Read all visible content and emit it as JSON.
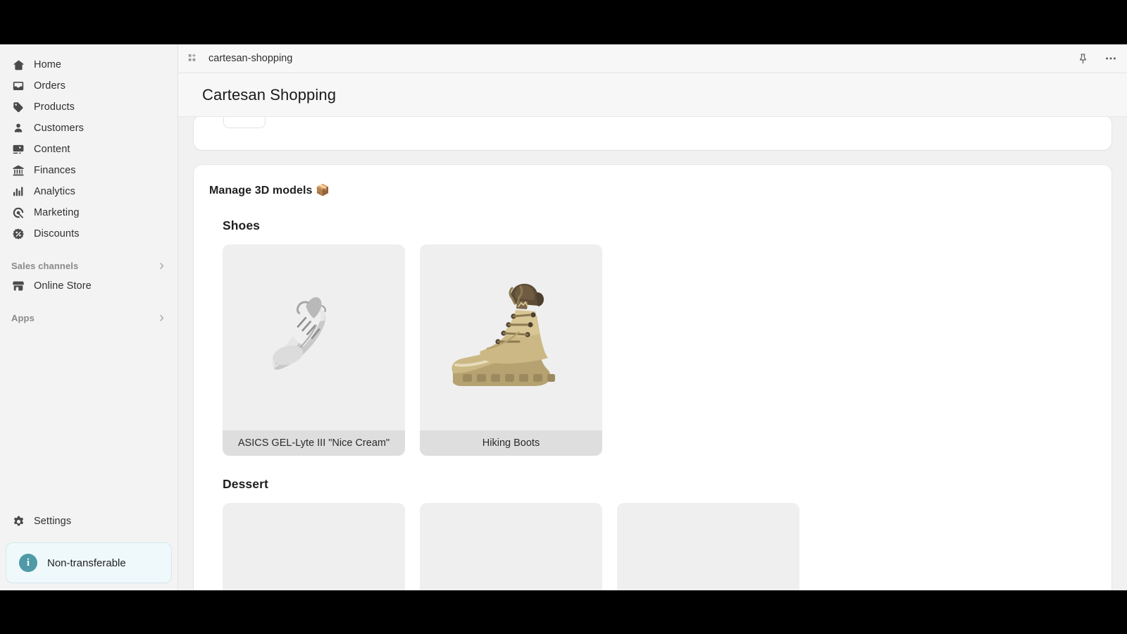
{
  "sidebar": {
    "items": [
      {
        "label": "Home",
        "icon": "home-icon"
      },
      {
        "label": "Orders",
        "icon": "orders-inbox-icon"
      },
      {
        "label": "Products",
        "icon": "products-tag-icon"
      },
      {
        "label": "Customers",
        "icon": "customers-person-icon"
      },
      {
        "label": "Content",
        "icon": "content-image-icon"
      },
      {
        "label": "Finances",
        "icon": "finances-bank-icon"
      },
      {
        "label": "Analytics",
        "icon": "analytics-bars-icon"
      },
      {
        "label": "Marketing",
        "icon": "marketing-target-icon"
      },
      {
        "label": "Discounts",
        "icon": "discounts-percent-icon"
      }
    ],
    "sales_channels": {
      "label": "Sales channels",
      "chevron": "chevron-right-icon"
    },
    "online_store": {
      "label": "Online Store",
      "icon": "store-icon"
    },
    "apps": {
      "label": "Apps",
      "chevron": "chevron-right-icon"
    },
    "settings": {
      "label": "Settings",
      "icon": "gear-icon"
    },
    "badge": {
      "label": "Non-transferable",
      "icon": "info-icon",
      "color": "#4f9aa8",
      "background": "#eff9fb"
    }
  },
  "topbar": {
    "app_icon": "grid-plus-icon",
    "app_name": "cartesan-shopping",
    "pin_icon": "pin-icon",
    "more_icon": "more-horizontal-icon"
  },
  "page": {
    "title": "Cartesan Shopping"
  },
  "main": {
    "card_title": "Manage 3D models",
    "card_title_emoji": "📦",
    "groups": [
      {
        "title": "Shoes",
        "tiles": [
          {
            "label": "ASICS GEL-Lyte III \"Nice Cream\"",
            "model": "sneaker-3d-model"
          },
          {
            "label": "Hiking Boots",
            "model": "hiking-boot-3d-model"
          }
        ]
      },
      {
        "title": "Dessert",
        "tiles": [
          {
            "label": "",
            "model": ""
          },
          {
            "label": "",
            "model": ""
          },
          {
            "label": "",
            "model": ""
          }
        ]
      }
    ]
  }
}
